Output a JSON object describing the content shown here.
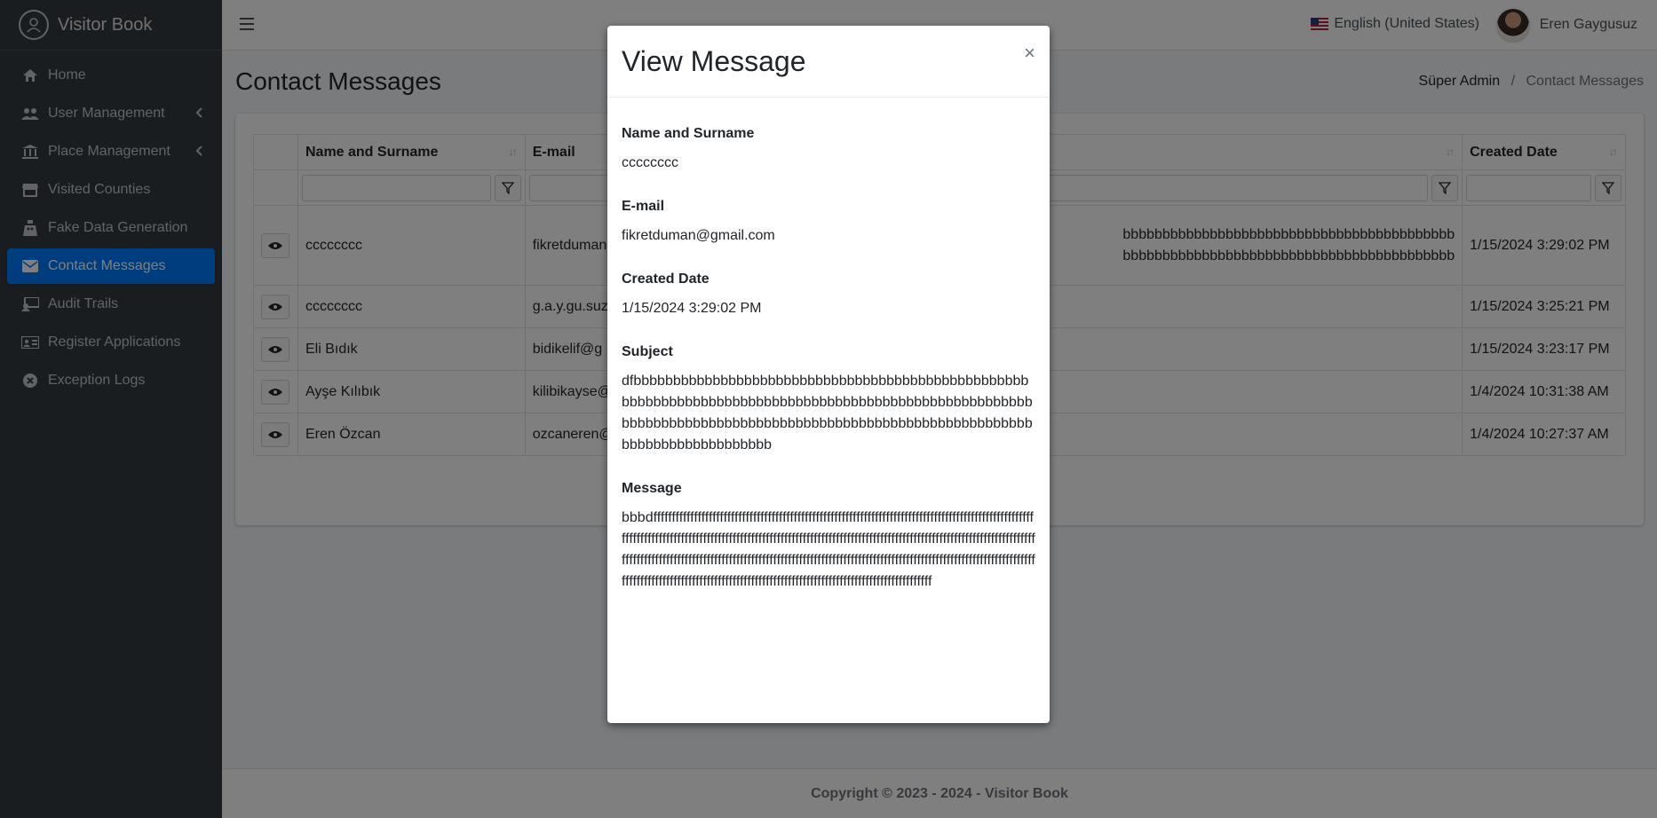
{
  "app": {
    "brand": "Visitor Book"
  },
  "sidebar": {
    "items": [
      {
        "label": "Home",
        "icon": "home-icon"
      },
      {
        "label": "User Management",
        "icon": "users-icon",
        "caret": true
      },
      {
        "label": "Place Management",
        "icon": "bank-icon",
        "caret": true
      },
      {
        "label": "Visited Counties",
        "icon": "store-icon"
      },
      {
        "label": "Fake Data Generation",
        "icon": "robot-icon"
      },
      {
        "label": "Contact Messages",
        "icon": "envelope-icon",
        "active": true
      },
      {
        "label": "Audit Trails",
        "icon": "audit-icon"
      },
      {
        "label": "Register Applications",
        "icon": "id-card-icon"
      },
      {
        "label": "Exception Logs",
        "icon": "error-icon"
      }
    ]
  },
  "header": {
    "language": "English (United States)",
    "user": "Eren Gaygusuz"
  },
  "page": {
    "title": "Contact Messages",
    "breadcrumb": {
      "root": "Süper Admin",
      "separator": "/",
      "current": "Contact Messages"
    }
  },
  "table": {
    "columns": {
      "name": "Name and Surname",
      "email": "E-mail",
      "created": "Created Date"
    },
    "rows": [
      {
        "name": "cccccccc",
        "email": "fikretduman",
        "message_line1": "bbbbbbbbbbbbbbbbbbbbbbbbbbbbbbbbbbbbbbbbbb",
        "message_line2": "bbbbbbbbbbbbbbbbbbbbbbbbbbbbbbbbbbbbbbbbbb",
        "created": "1/15/2024 3:29:02 PM"
      },
      {
        "name": "cccccccc",
        "email": "g.a.y.gu.suz",
        "created": "1/15/2024 3:25:21 PM"
      },
      {
        "name": "Eli Bıdık",
        "email": "bidikelif@g",
        "created": "1/15/2024 3:23:17 PM"
      },
      {
        "name": "Ayşe Kılıbık",
        "email": "kilibikayse@",
        "created": "1/4/2024 10:31:38 AM"
      },
      {
        "name": "Eren Özcan",
        "email": "ozcaneren@",
        "created": "1/4/2024 10:27:37 AM"
      }
    ]
  },
  "footer": {
    "copyright": "Copyright © 2023 - 2024 - Visitor Book"
  },
  "modal": {
    "title": "View Message",
    "close": "×",
    "fields": {
      "name_label": "Name and Surname",
      "name_value": "cccccccc",
      "email_label": "E-mail",
      "email_value": "fikretduman@gmail.com",
      "created_label": "Created Date",
      "created_value": "1/15/2024 3:29:02 PM",
      "subject_label": "Subject",
      "subject_value": "dfbbbbbbbbbbbbbbbbbbbbbbbbbbbbbbbbbbbbbbbbbbbbbbbbbbbbbbbbbbbbbbbbbbbbbbbbbbbbbbbbbbbbbbbbbbbbbbbbbbbbbbbbbbbbbbbbbbbbbbbbbbbbbbbbbbbbbbbbbbbbbbbbbbbbbbbbbbbbbbbbbbbbbbbbbbbbb",
      "message_label": "Message",
      "message_value": "bbbdfffffffffffffffffffffffffffffffffffffffffffffffffffffffffffffffffffffffffffffffffffffffffffffffffffffffffffffffffffffffffffffffffffffffffffffffffffffffffffffffffffffffffffffffffffffffffffffffffffffffffffffffffffffffffffffffffffffffffffffffffffffffffffffffffffffffffffffffffffffffffffffffffffffffffffffffffffffffffffffffffffffffffffffffffffffffffffffffffffffffffffffffffffffffffffffffffffffffffffffffffffffffffff"
    }
  }
}
